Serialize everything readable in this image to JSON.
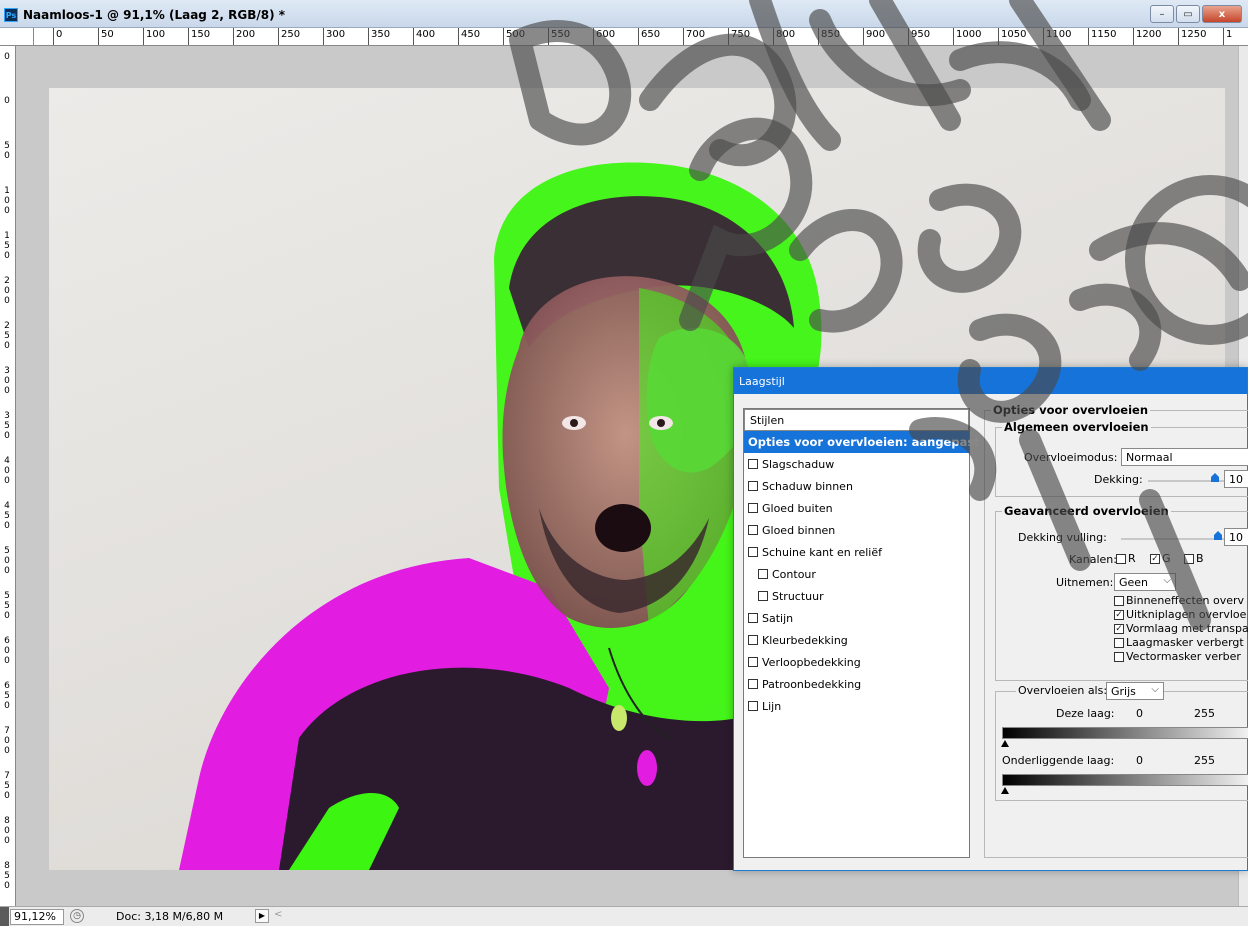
{
  "window": {
    "title": "Naamloos-1 @ 91,1% (Laag 2, RGB/8) *",
    "app_icon": "Ps",
    "minimize_icon": "–",
    "restore_icon": "▭",
    "close_icon": "x"
  },
  "ruler": {
    "top_ticks": [
      "0",
      "50",
      "100",
      "150",
      "200",
      "250",
      "300",
      "350",
      "400",
      "450",
      "500",
      "550",
      "600",
      "650",
      "700",
      "750",
      "800",
      "850",
      "900",
      "950",
      "1000",
      "1050",
      "1100",
      "1150",
      "1200",
      "1250",
      "1"
    ],
    "left_ticks": [
      "0",
      "5 0",
      "1 0 0",
      "1 5 0",
      "2 0 0",
      "2 5 0",
      "3 0 0",
      "3 5 0",
      "4 0 0",
      "4 5 0",
      "5 0 0",
      "5 5 0",
      "6 0 0",
      "6 5 0",
      "7 0 0",
      "7 5 0",
      "8 0 0",
      "8 5 0"
    ],
    "left_top": "0"
  },
  "status": {
    "zoom": "91,12%",
    "doc_info": "Doc: 3,18 M/6,80 M",
    "arrow": "▶",
    "scroll_left": "<"
  },
  "dialog": {
    "title": "Laagstijl",
    "styles_header": "Stijlen",
    "items": [
      {
        "label": "Opties voor overvloeien: aangepast",
        "active": true,
        "checkbox": false,
        "indent": false
      },
      {
        "label": "Slagschaduw",
        "active": false,
        "checkbox": true,
        "indent": false
      },
      {
        "label": "Schaduw binnen",
        "active": false,
        "checkbox": true,
        "indent": false
      },
      {
        "label": "Gloed buiten",
        "active": false,
        "checkbox": true,
        "indent": false
      },
      {
        "label": "Gloed binnen",
        "active": false,
        "checkbox": true,
        "indent": false
      },
      {
        "label": "Schuine kant en reliëf",
        "active": false,
        "checkbox": true,
        "indent": false
      },
      {
        "label": "Contour",
        "active": false,
        "checkbox": true,
        "indent": true
      },
      {
        "label": "Structuur",
        "active": false,
        "checkbox": true,
        "indent": true
      },
      {
        "label": "Satijn",
        "active": false,
        "checkbox": true,
        "indent": false
      },
      {
        "label": "Kleurbedekking",
        "active": false,
        "checkbox": true,
        "indent": false
      },
      {
        "label": "Verloopbedekking",
        "active": false,
        "checkbox": true,
        "indent": false
      },
      {
        "label": "Patroonbedekking",
        "active": false,
        "checkbox": true,
        "indent": false
      },
      {
        "label": "Lijn",
        "active": false,
        "checkbox": true,
        "indent": false
      }
    ],
    "blend": {
      "section_title": "Opties voor overvloeien",
      "general_title": "Algemeen overvloeien",
      "mode_label": "Overvloeimodus:",
      "mode_value": "Normaal",
      "opacity_label": "Dekking:",
      "opacity_value": "10",
      "advanced_title": "Geavanceerd overvloeien",
      "fill_label": "Dekking vulling:",
      "fill_value": "10",
      "channels_label": "Kanalen:",
      "channel_r": "R",
      "channel_g": "G",
      "channel_b": "B",
      "channel_r_checked": false,
      "channel_g_checked": true,
      "channel_b_checked": false,
      "knockout_label": "Uitnemen:",
      "knockout_value": "Geen",
      "options": [
        {
          "label": "Binneneffecten overv",
          "checked": false
        },
        {
          "label": "Uitkniplagen overvloe",
          "checked": true
        },
        {
          "label": "Vormlaag met transpa",
          "checked": true
        },
        {
          "label": "Laagmasker verbergt",
          "checked": false
        },
        {
          "label": "Vectormasker verber",
          "checked": false
        }
      ],
      "blend_if_label": "Overvloeien als:",
      "blend_if_value": "Grijs",
      "this_layer_label": "Deze laag:",
      "this_layer_min": "0",
      "this_layer_max": "255",
      "underlying_label": "Onderliggende laag:",
      "underlying_min": "0",
      "underlying_max": "255"
    }
  },
  "colors": {
    "accent": "#1573d9",
    "magenta": "#e21ce0",
    "green": "#3cf510",
    "canvas_bg": "#c9c9c9"
  }
}
